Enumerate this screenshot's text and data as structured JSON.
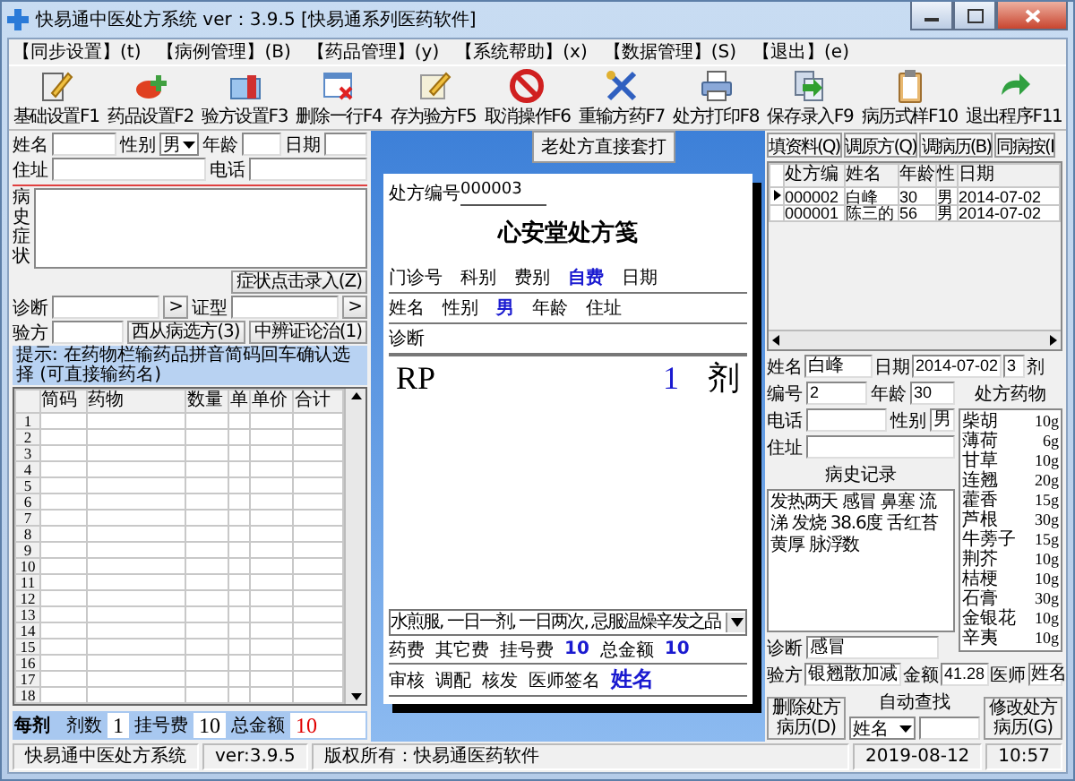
{
  "window": {
    "title": "快易通中医处方系统  ver：3.9.5 [快易通系列医药软件]"
  },
  "menu": [
    "【同步设置】(t)",
    "【病例管理】(B)",
    "【药品管理】(y)",
    "【系统帮助】(x)",
    "【数据管理】(S)",
    "【退出】(e)"
  ],
  "toolbar": [
    "基础设置F1",
    "药品设置F2",
    "验方设置F3",
    "删除一行F4",
    "存为验方F5",
    "取消操作F6",
    "重输方药F7",
    "处方打印F8",
    "保存录入F9",
    "病历式样F10",
    "退出程序F11"
  ],
  "patient_form": {
    "name_label": "姓名",
    "sex_label": "性别",
    "sex": "男",
    "age_label": "年龄",
    "date_label": "日期",
    "address_label": "住址",
    "phone_label": "电话",
    "history_label": "病史症状",
    "symptom_button": "症状点击录入(Z)",
    "diagnosis_label": "诊断",
    "diagnosis_button": ">",
    "syndrome_label": "证型",
    "syndrome_button": ">",
    "formula_label": "验方",
    "western_button": "西从病选方(3)",
    "tcm_button": "中辨证论治(1)",
    "hint": "提示: 在药物栏输药品拼音简码回车确认选择 (可直接输药名)"
  },
  "drug_grid": {
    "columns": [
      "简码",
      "药物",
      "数量",
      "单",
      "单价",
      "合计"
    ],
    "row_numbers": [
      "1",
      "2",
      "3",
      "4",
      "5",
      "6",
      "7",
      "8",
      "9",
      "10",
      "11",
      "12",
      "13",
      "14",
      "15",
      "16",
      "17",
      "18"
    ]
  },
  "totals": {
    "per_dose_label": "每剂",
    "doses_label": "剂数",
    "doses": "1",
    "fee_label": "挂号费",
    "fee": "10",
    "total_label": "总金额",
    "total": "10"
  },
  "template_button": "老处方直接套打",
  "prescription": {
    "number_label": "处方编号",
    "number": "000003",
    "title": "心安堂处方笺",
    "row1": [
      {
        "text": "门诊号",
        "kind": "label"
      },
      {
        "text": "科别",
        "kind": "label"
      },
      {
        "text": "费别",
        "kind": "label"
      },
      {
        "text": "自费",
        "kind": "value"
      },
      {
        "text": "日期",
        "kind": "label"
      }
    ],
    "row2": [
      {
        "text": "姓名",
        "kind": "label"
      },
      {
        "text": "性别",
        "kind": "label"
      },
      {
        "text": "男",
        "kind": "value"
      },
      {
        "text": "年龄",
        "kind": "label"
      },
      {
        "text": "住址",
        "kind": "label"
      }
    ],
    "diagnosis_label": "诊断",
    "rp": "RP",
    "doses": "1",
    "dose_unit": "剂",
    "usage": "水煎服, 一日一剂, 一日两次, 忌服温燥辛发之品",
    "fees": [
      {
        "text": "药费",
        "kind": "label"
      },
      {
        "text": "其它费",
        "kind": "label"
      },
      {
        "text": "挂号费",
        "kind": "label"
      },
      {
        "text": "10",
        "kind": "value"
      },
      {
        "text": "总金额",
        "kind": "label"
      },
      {
        "text": "10",
        "kind": "value"
      }
    ],
    "signatures": [
      {
        "text": "审核",
        "kind": "label"
      },
      {
        "text": "调配",
        "kind": "label"
      },
      {
        "text": "核发",
        "kind": "label"
      },
      {
        "text": "医师签名",
        "kind": "label"
      },
      {
        "text": "姓名",
        "kind": "signature"
      }
    ]
  },
  "right_tabs": [
    "填资料(Q)",
    "调原方(Q)",
    "调病历(B)",
    "同病按(I"
  ],
  "records": {
    "columns": [
      "处方编",
      "姓名",
      "年龄",
      "性",
      "日期"
    ],
    "rows": [
      {
        "cells": [
          "000002",
          "白峰",
          "30",
          "男",
          "2014-07-02"
        ],
        "selected": true
      },
      {
        "cells": [
          "000001",
          "陈三的",
          "56",
          "男",
          "2014-07-02"
        ],
        "selected": false
      }
    ]
  },
  "record_form": {
    "name_label": "姓名",
    "name": "白峰",
    "date_label": "日期",
    "date": "2014-07-02",
    "doses": "3",
    "dose_unit": "剂",
    "id_label": "编号",
    "id": "2",
    "age_label": "年龄",
    "age": "30",
    "drugs_label": "处方药物",
    "phone_label": "电话",
    "sex_label": "性别",
    "sex": "男",
    "address_label": "住址",
    "history_label": "病史记录",
    "history": [
      "发热两天 感冒 鼻塞 流",
      "涕 发烧 38.6度 舌红苔",
      "黄厚 脉浮数"
    ],
    "drugs": [
      {
        "name": "柴胡",
        "dose": "10g"
      },
      {
        "name": "薄荷",
        "dose": "6g"
      },
      {
        "name": "甘草",
        "dose": "10g"
      },
      {
        "name": "连翘",
        "dose": "20g"
      },
      {
        "name": "藿香",
        "dose": "15g"
      },
      {
        "name": "芦根",
        "dose": "30g"
      },
      {
        "name": "牛蒡子",
        "dose": "15g"
      },
      {
        "name": "荆芥",
        "dose": "10g"
      },
      {
        "name": "桔梗",
        "dose": "10g"
      },
      {
        "name": "石膏",
        "dose": "30g"
      },
      {
        "name": "金银花",
        "dose": "10g"
      },
      {
        "name": "辛夷",
        "dose": "10g"
      }
    ],
    "diagnosis_label": "诊断",
    "diagnosis": "感冒",
    "formula_label": "验方",
    "formula": "银翘散加减",
    "amount_label": "金额",
    "amount": "41.28",
    "doctor_label": "医师",
    "doctor": "姓名",
    "delete_button": "删除处方病历(D)",
    "search_label": "自动查找",
    "search_field": "姓名",
    "edit_button": "修改处方病历(G)"
  },
  "status_bar": [
    "快易通中医处方系统",
    "ver:3.9.5",
    "版权所有：快易通医药软件",
    "2019-08-12",
    "10:57"
  ]
}
